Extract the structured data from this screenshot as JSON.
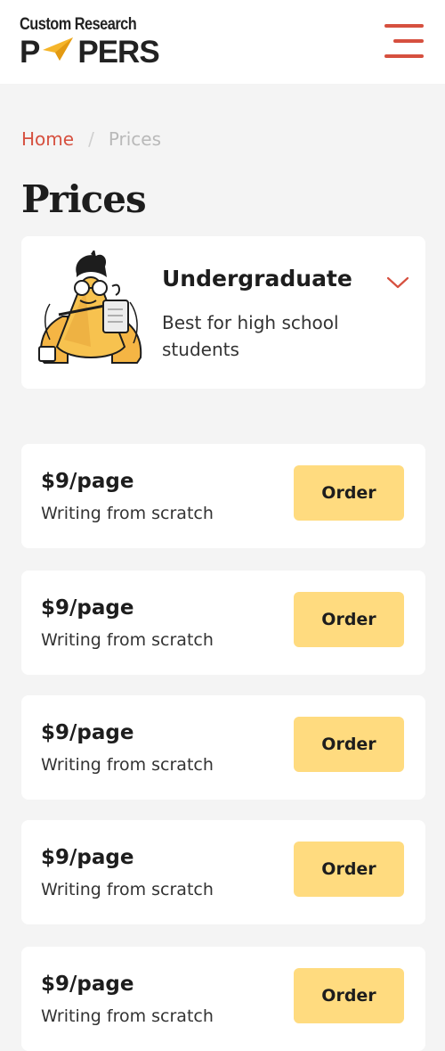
{
  "header": {
    "logo_top": "Custom Research",
    "logo_p": "P",
    "logo_rest": "PERS",
    "menu_icon": "hamburger-menu-icon",
    "accent_color": "#d6503f"
  },
  "breadcrumb": {
    "home": "Home",
    "separator": "/",
    "current": "Prices"
  },
  "page_title": "Prices",
  "level_selector": {
    "name": "Undergraduate",
    "description": "Best for high school students",
    "icon": "chevron-down-icon"
  },
  "prices": [
    {
      "price": "$9/page",
      "description": "Writing from scratch",
      "button": "Order"
    },
    {
      "price": "$9/page",
      "description": "Writing from scratch",
      "button": "Order"
    },
    {
      "price": "$9/page",
      "description": "Writing from scratch",
      "button": "Order"
    },
    {
      "price": "$9/page",
      "description": "Writing from scratch",
      "button": "Order"
    },
    {
      "price": "$9/page",
      "description": "Writing from scratch",
      "button": "Order"
    }
  ],
  "colors": {
    "button_bg": "#ffdb7f",
    "page_bg": "#f4f4f4",
    "card_bg": "#ffffff"
  }
}
